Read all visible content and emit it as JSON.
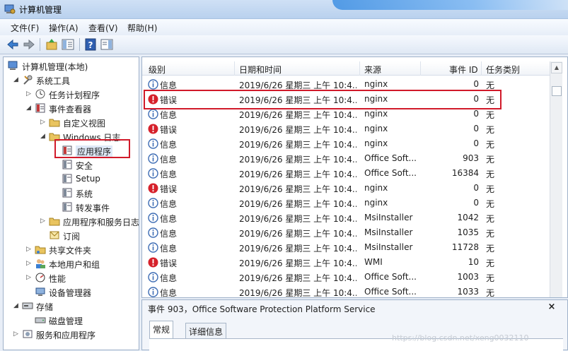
{
  "window": {
    "title": "计算机管理"
  },
  "menu": {
    "items": [
      "文件(F)",
      "操作(A)",
      "查看(V)",
      "帮助(H)"
    ]
  },
  "toolbar": {
    "buttons": [
      "back-arrow-icon",
      "forward-arrow-icon",
      "up-folder-icon",
      "show-hide-tree-icon",
      "help-icon",
      "show-action-pane-icon"
    ]
  },
  "tree": {
    "items": [
      {
        "label": "计算机管理(本地)",
        "icon": "computer-management-icon",
        "expanded": true
      },
      {
        "label": "系统工具",
        "icon": "tools-icon",
        "expanded": true
      },
      {
        "label": "任务计划程序",
        "icon": "clock-icon",
        "expanded": false
      },
      {
        "label": "事件查看器",
        "icon": "event-viewer-icon",
        "expanded": true
      },
      {
        "label": "自定义视图",
        "icon": "folder-icon",
        "expanded": false
      },
      {
        "label": "Windows 日志",
        "icon": "folder-icon",
        "expanded": true
      },
      {
        "label": "应用程序",
        "icon": "log-icon",
        "selected": true
      },
      {
        "label": "安全",
        "icon": "log-icon"
      },
      {
        "label": "Setup",
        "icon": "log-icon"
      },
      {
        "label": "系统",
        "icon": "log-icon"
      },
      {
        "label": "转发事件",
        "icon": "log-icon"
      },
      {
        "label": "应用程序和服务日志",
        "icon": "folder-icon",
        "expanded": false
      },
      {
        "label": "订阅",
        "icon": "subscription-icon"
      },
      {
        "label": "共享文件夹",
        "icon": "shared-folder-icon",
        "expanded": false
      },
      {
        "label": "本地用户和组",
        "icon": "users-icon",
        "expanded": false
      },
      {
        "label": "性能",
        "icon": "performance-icon",
        "expanded": false
      },
      {
        "label": "设备管理器",
        "icon": "device-manager-icon"
      },
      {
        "label": "存储",
        "icon": "storage-icon",
        "expanded": true
      },
      {
        "label": "磁盘管理",
        "icon": "disk-icon"
      },
      {
        "label": "服务和应用程序",
        "icon": "services-icon",
        "expanded": false
      }
    ]
  },
  "table": {
    "columns": [
      "级别",
      "日期和时间",
      "来源",
      "事件 ID",
      "任务类别"
    ],
    "rows": [
      {
        "level": "信息",
        "type": "info",
        "datetime": "2019/6/26 星期三 上午 10:4...",
        "source": "nginx",
        "event_id": "0",
        "category": "无"
      },
      {
        "level": "错误",
        "type": "error",
        "datetime": "2019/6/26 星期三 上午 10:4...",
        "source": "nginx",
        "event_id": "0",
        "category": "无"
      },
      {
        "level": "信息",
        "type": "info",
        "datetime": "2019/6/26 星期三 上午 10:4...",
        "source": "nginx",
        "event_id": "0",
        "category": "无"
      },
      {
        "level": "错误",
        "type": "error",
        "datetime": "2019/6/26 星期三 上午 10:4...",
        "source": "nginx",
        "event_id": "0",
        "category": "无"
      },
      {
        "level": "信息",
        "type": "info",
        "datetime": "2019/6/26 星期三 上午 10:4...",
        "source": "nginx",
        "event_id": "0",
        "category": "无"
      },
      {
        "level": "信息",
        "type": "info",
        "datetime": "2019/6/26 星期三 上午 10:4...",
        "source": "Office Soft...",
        "event_id": "903",
        "category": "无"
      },
      {
        "level": "信息",
        "type": "info",
        "datetime": "2019/6/26 星期三 上午 10:4...",
        "source": "Office Soft...",
        "event_id": "16384",
        "category": "无"
      },
      {
        "level": "错误",
        "type": "error",
        "datetime": "2019/6/26 星期三 上午 10:4...",
        "source": "nginx",
        "event_id": "0",
        "category": "无"
      },
      {
        "level": "信息",
        "type": "info",
        "datetime": "2019/6/26 星期三 上午 10:4...",
        "source": "nginx",
        "event_id": "0",
        "category": "无"
      },
      {
        "level": "信息",
        "type": "info",
        "datetime": "2019/6/26 星期三 上午 10:4...",
        "source": "MsiInstaller",
        "event_id": "1042",
        "category": "无"
      },
      {
        "level": "信息",
        "type": "info",
        "datetime": "2019/6/26 星期三 上午 10:4...",
        "source": "MsiInstaller",
        "event_id": "1035",
        "category": "无"
      },
      {
        "level": "信息",
        "type": "info",
        "datetime": "2019/6/26 星期三 上午 10:4...",
        "source": "MsiInstaller",
        "event_id": "11728",
        "category": "无"
      },
      {
        "level": "错误",
        "type": "error",
        "datetime": "2019/6/26 星期三 上午 10:4...",
        "source": "WMI",
        "event_id": "10",
        "category": "无"
      },
      {
        "level": "信息",
        "type": "info",
        "datetime": "2019/6/26 星期三 上午 10:4...",
        "source": "Office Soft...",
        "event_id": "1003",
        "category": "无"
      },
      {
        "level": "信息",
        "type": "info",
        "datetime": "2019/6/26 星期三 上午 10:4...",
        "source": "Office Soft...",
        "event_id": "1033",
        "category": "无"
      }
    ]
  },
  "detail": {
    "title": "事件 903，Office Software Protection Platform Service",
    "close": "×",
    "tabs": [
      "常规",
      "详细信息"
    ]
  },
  "watermark": "https://blog.csdn.net/xeng0032110",
  "colors": {
    "error": "#d6212b",
    "info": "#3d6cb4",
    "annotation": "#d11a2a"
  }
}
